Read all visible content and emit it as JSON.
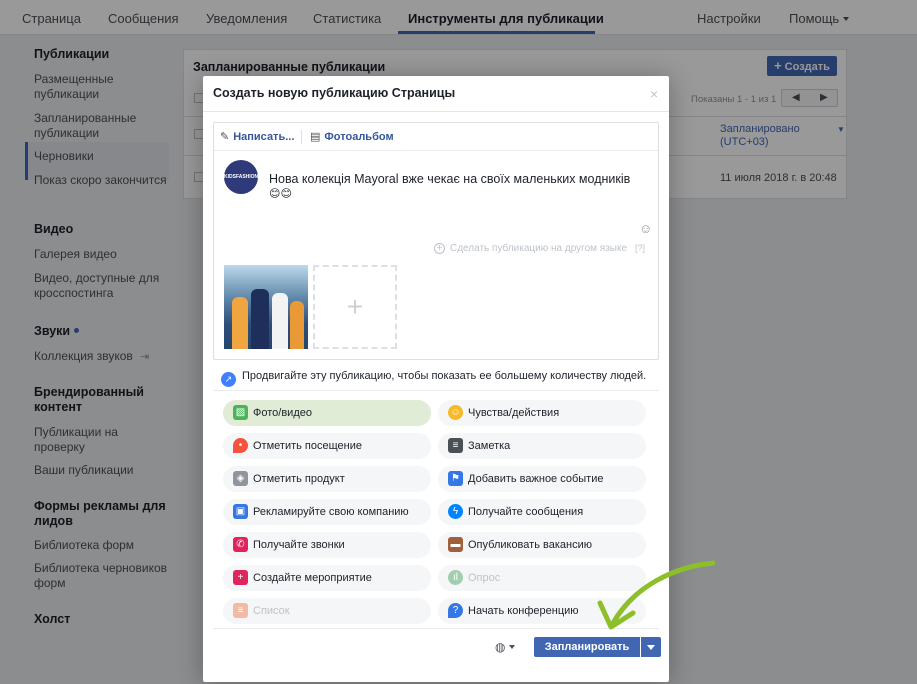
{
  "topnav": {
    "items": [
      "Страница",
      "Сообщения",
      "Уведомления",
      "Статистика",
      "Инструменты для публикации"
    ],
    "settings": "Настройки",
    "help": "Помощь"
  },
  "sidebar": {
    "sections": [
      {
        "heading": "Публикации",
        "items": [
          "Размещенные публикации",
          "Запланированные публикации",
          "Черновики",
          "Показ скоро закончится"
        ]
      },
      {
        "heading": "Видео",
        "items": [
          "Галерея видео",
          "Видео, доступные для кросспостинга"
        ]
      },
      {
        "heading": "Звуки",
        "items": [
          "Коллекция звуков"
        ]
      },
      {
        "heading": "Брендированный контент",
        "items": [
          "Публикации на проверку",
          "Ваши публикации"
        ]
      },
      {
        "heading": "Формы рекламы для лидов",
        "items": [
          "Библиотека форм",
          "Библиотека черновиков форм"
        ]
      },
      {
        "heading": "Холст",
        "items": []
      }
    ]
  },
  "background_panel": {
    "title": "Запланированные публикации",
    "create_button": "Создать",
    "shown_text": "Показаны 1 - 1 из 1",
    "column_header": "Запланировано (UTC+03)",
    "row_date": "11 июля 2018 г. в 20:48"
  },
  "modal": {
    "title": "Создать новую публикацию Страницы",
    "close": "×",
    "tabs": [
      "Написать...",
      "Фотоальбом"
    ],
    "avatar_text": "KIDSFASHION",
    "post_text": "Нова колекція Mayoral вже чекає на своїх маленьких модників",
    "emoji": "😊😊",
    "other_language": "Сделать публикацию на другом языке",
    "other_language_help": "[?]",
    "boost_text": "Продвигайте эту публикацию, чтобы показать ее большему количеству людей.",
    "options": [
      {
        "label": "Фото/видео",
        "icon": "photo-video-icon",
        "color": "#4bb35a",
        "state": "selected"
      },
      {
        "label": "Чувства/действия",
        "icon": "feeling-icon",
        "color": "#f7b928",
        "state": "normal"
      },
      {
        "label": "Отметить посещение",
        "icon": "checkin-icon",
        "color": "#f5533d",
        "state": "normal"
      },
      {
        "label": "Заметка",
        "icon": "note-icon",
        "color": "#4b4f56",
        "state": "normal"
      },
      {
        "label": "Отметить продукт",
        "icon": "tag-product-icon",
        "color": "#90949c",
        "state": "normal"
      },
      {
        "label": "Добавить важное событие",
        "icon": "milestone-flag-icon",
        "color": "#3578e5",
        "state": "normal"
      },
      {
        "label": "Рекламируйте свою компанию",
        "icon": "promote-business-icon",
        "color": "#3578e5",
        "state": "normal"
      },
      {
        "label": "Получайте сообщения",
        "icon": "messenger-icon",
        "color": "#0084ff",
        "state": "normal"
      },
      {
        "label": "Получайте звонки",
        "icon": "phone-icon",
        "color": "#e0245e",
        "state": "normal"
      },
      {
        "label": "Опубликовать вакансию",
        "icon": "job-briefcase-icon",
        "color": "#a0613a",
        "state": "normal"
      },
      {
        "label": "Создайте мероприятие",
        "icon": "event-calendar-icon",
        "color": "#e0245e",
        "state": "normal"
      },
      {
        "label": "Опрос",
        "icon": "poll-icon",
        "color": "#a3cdb0",
        "state": "disabled"
      },
      {
        "label": "Список",
        "icon": "list-icon",
        "color": "#f4b9a3",
        "state": "disabled"
      },
      {
        "label": "Начать конференцию",
        "icon": "question-icon",
        "color": "#3578e5",
        "state": "normal"
      }
    ],
    "schedule_button": "Запланировать"
  },
  "colors": {
    "accent": "#4267b2",
    "annotation_arrow": "#8dbf2a"
  }
}
